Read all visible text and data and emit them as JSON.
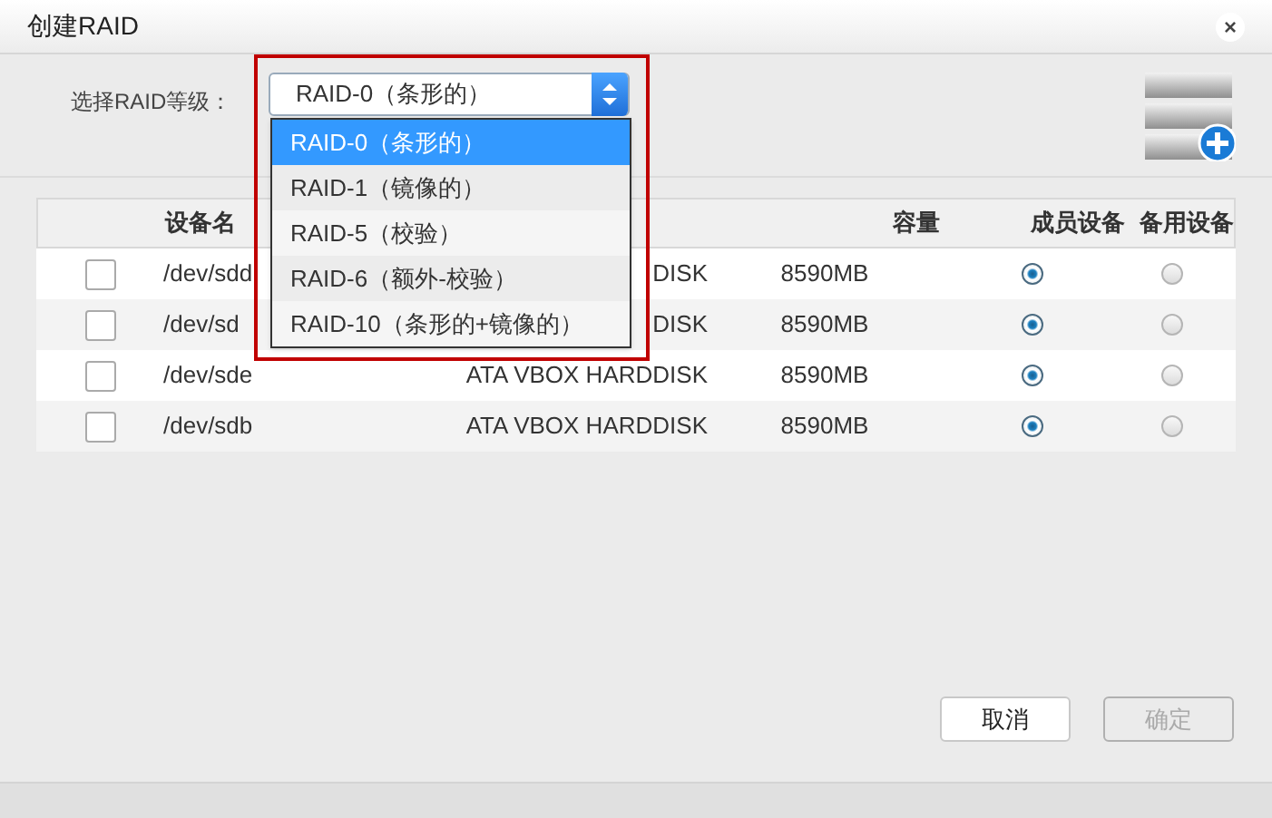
{
  "window": {
    "title": "创建RAID",
    "close": "×"
  },
  "level_select": {
    "label": "选择RAID等级：",
    "value": "RAID-0（条形的）",
    "expanded": true,
    "options": [
      {
        "label": "RAID-0（条形的）",
        "selected": true
      },
      {
        "label": "RAID-1（镜像的）",
        "selected": false
      },
      {
        "label": "RAID-5（校验）",
        "selected": false
      },
      {
        "label": "RAID-6（额外-校验）",
        "selected": false
      },
      {
        "label": "RAID-10（条形的+镜像的）",
        "selected": false
      }
    ]
  },
  "table": {
    "columns": [
      "设备名",
      "容量",
      "成员设备",
      "备用设备"
    ],
    "rows": [
      {
        "checked": false,
        "device": "/dev/sdd",
        "model": "DISK",
        "capacity": "8590MB",
        "member": true,
        "spare": false
      },
      {
        "checked": false,
        "device": "/dev/sd",
        "model": "DISK",
        "capacity": "8590MB",
        "member": true,
        "spare": false
      },
      {
        "checked": false,
        "device": "/dev/sde",
        "model": "ATA VBOX HARDDISK",
        "capacity": "8590MB",
        "member": true,
        "spare": false
      },
      {
        "checked": false,
        "device": "/dev/sdb",
        "model": "ATA VBOX HARDDISK",
        "capacity": "8590MB",
        "member": true,
        "spare": false
      }
    ]
  },
  "buttons": [
    {
      "label": "取消",
      "disabled": false
    },
    {
      "label": "确定",
      "disabled": true
    }
  ]
}
